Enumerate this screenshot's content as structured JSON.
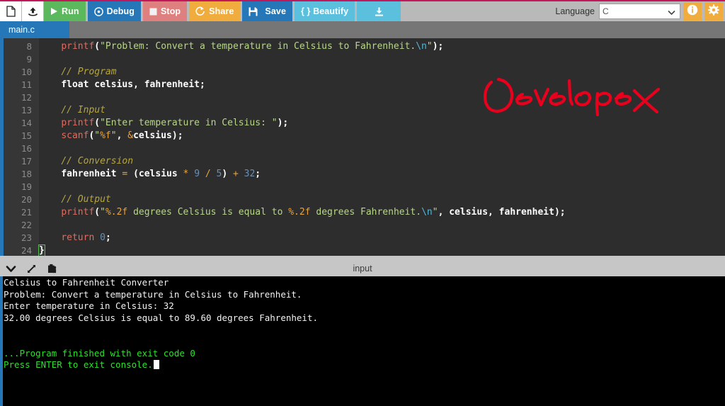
{
  "toolbar": {
    "buttons": [
      {
        "name": "new-file-button",
        "label": "",
        "icon": "file-icon"
      },
      {
        "name": "upload-button",
        "label": "",
        "icon": "upload-icon"
      },
      {
        "name": "run-button",
        "label": "Run",
        "icon": "play-icon"
      },
      {
        "name": "debug-button",
        "label": "Debug",
        "icon": "debug-icon"
      },
      {
        "name": "stop-button",
        "label": "Stop",
        "icon": "stop-icon"
      },
      {
        "name": "share-button",
        "label": "Share",
        "icon": "share-icon"
      },
      {
        "name": "save-button",
        "label": "Save",
        "icon": "floppy-icon"
      },
      {
        "name": "beautify-button",
        "label": "{ } Beautify",
        "icon": "braces-icon"
      },
      {
        "name": "download-button",
        "label": "",
        "icon": "download-icon"
      }
    ],
    "run_label": "Run",
    "debug_label": "Debug",
    "stop_label": "Stop",
    "share_label": "Share",
    "save_label": "Save",
    "beautify_label": "{ } Beautify",
    "language_label": "Language",
    "language_value": "C",
    "info_icon": "info-icon",
    "settings_icon": "gear-icon",
    "accent_pink": "#c2185b",
    "accent_green": "#5cb85c",
    "accent_blue": "#2577b8",
    "accent_orange": "#f0ad3e"
  },
  "tabs": [
    {
      "label": "main.c",
      "active": true
    }
  ],
  "editor": {
    "first_line_number": 8,
    "lines": [
      {
        "n": 8,
        "tokens": [
          {
            "t": "    ",
            "c": "pn"
          },
          {
            "t": "printf",
            "c": "fn"
          },
          {
            "t": "(",
            "c": "pn"
          },
          {
            "t": "\"Problem: Convert a temperature in Celsius to Fahrenheit.",
            "c": "str"
          },
          {
            "t": "\\n",
            "c": "esc"
          },
          {
            "t": "\"",
            "c": "str"
          },
          {
            "t": ");",
            "c": "pn"
          }
        ]
      },
      {
        "n": 9,
        "tokens": []
      },
      {
        "n": 10,
        "tokens": [
          {
            "t": "    ",
            "c": "pn"
          },
          {
            "t": "// Program",
            "c": "cmt"
          }
        ]
      },
      {
        "n": 11,
        "tokens": [
          {
            "t": "    ",
            "c": "pn"
          },
          {
            "t": "float",
            "c": "kw"
          },
          {
            "t": " celsius, fahrenheit;",
            "c": "id"
          }
        ]
      },
      {
        "n": 12,
        "tokens": []
      },
      {
        "n": 13,
        "tokens": [
          {
            "t": "    ",
            "c": "pn"
          },
          {
            "t": "// Input",
            "c": "cmt"
          }
        ]
      },
      {
        "n": 14,
        "tokens": [
          {
            "t": "    ",
            "c": "pn"
          },
          {
            "t": "printf",
            "c": "fn"
          },
          {
            "t": "(",
            "c": "pn"
          },
          {
            "t": "\"Enter temperature in Celsius: \"",
            "c": "str"
          },
          {
            "t": ");",
            "c": "pn"
          }
        ]
      },
      {
        "n": 15,
        "tokens": [
          {
            "t": "    ",
            "c": "pn"
          },
          {
            "t": "scanf",
            "c": "fn"
          },
          {
            "t": "(",
            "c": "pn"
          },
          {
            "t": "\"",
            "c": "str"
          },
          {
            "t": "%f",
            "c": "op"
          },
          {
            "t": "\"",
            "c": "str"
          },
          {
            "t": ", ",
            "c": "pn"
          },
          {
            "t": "&",
            "c": "op"
          },
          {
            "t": "celsius",
            "c": "id"
          },
          {
            "t": ");",
            "c": "pn"
          }
        ]
      },
      {
        "n": 16,
        "tokens": []
      },
      {
        "n": 17,
        "tokens": [
          {
            "t": "    ",
            "c": "pn"
          },
          {
            "t": "// Conversion",
            "c": "cmt"
          }
        ]
      },
      {
        "n": 18,
        "tokens": [
          {
            "t": "    ",
            "c": "pn"
          },
          {
            "t": "fahrenheit",
            "c": "id"
          },
          {
            "t": " ",
            "c": "pn"
          },
          {
            "t": "=",
            "c": "op"
          },
          {
            "t": " (celsius ",
            "c": "id"
          },
          {
            "t": "*",
            "c": "op"
          },
          {
            "t": " ",
            "c": "pn"
          },
          {
            "t": "9",
            "c": "num"
          },
          {
            "t": " ",
            "c": "pn"
          },
          {
            "t": "/",
            "c": "op"
          },
          {
            "t": " ",
            "c": "pn"
          },
          {
            "t": "5",
            "c": "num"
          },
          {
            "t": ") ",
            "c": "id"
          },
          {
            "t": "+",
            "c": "op"
          },
          {
            "t": " ",
            "c": "pn"
          },
          {
            "t": "32",
            "c": "num"
          },
          {
            "t": ";",
            "c": "pn"
          }
        ]
      },
      {
        "n": 19,
        "tokens": []
      },
      {
        "n": 20,
        "tokens": [
          {
            "t": "    ",
            "c": "pn"
          },
          {
            "t": "// Output",
            "c": "cmt"
          }
        ]
      },
      {
        "n": 21,
        "tokens": [
          {
            "t": "    ",
            "c": "pn"
          },
          {
            "t": "printf",
            "c": "fn"
          },
          {
            "t": "(",
            "c": "pn"
          },
          {
            "t": "\"",
            "c": "str"
          },
          {
            "t": "%.2f",
            "c": "op"
          },
          {
            "t": " degrees Celsius is equal to ",
            "c": "str"
          },
          {
            "t": "%.2f",
            "c": "op"
          },
          {
            "t": " degrees Fahrenheit.",
            "c": "str"
          },
          {
            "t": "\\n",
            "c": "esc"
          },
          {
            "t": "\"",
            "c": "str"
          },
          {
            "t": ", celsius, fahrenheit);",
            "c": "pn"
          }
        ]
      },
      {
        "n": 22,
        "tokens": []
      },
      {
        "n": 23,
        "tokens": [
          {
            "t": "    ",
            "c": "pn"
          },
          {
            "t": "return",
            "c": "ret"
          },
          {
            "t": " ",
            "c": "pn"
          },
          {
            "t": "0",
            "c": "num"
          },
          {
            "t": ";",
            "c": "pn"
          }
        ]
      },
      {
        "n": 24,
        "tokens": [
          {
            "t": "}",
            "c": "brace-hl"
          }
        ]
      }
    ],
    "annotation_text": "Developer",
    "annotation_color": "#e8001c"
  },
  "console_header": {
    "title": "input",
    "icons": [
      "chevron-down-icon",
      "expand-icon",
      "clipboard-icon"
    ]
  },
  "console": {
    "lines": [
      {
        "text": "Celsius to Fahrenheit Converter",
        "color": "white"
      },
      {
        "text": "Problem: Convert a temperature in Celsius to Fahrenheit.",
        "color": "white"
      },
      {
        "text": "Enter temperature in Celsius: 32",
        "color": "white"
      },
      {
        "text": "32.00 degrees Celsius is equal to 89.60 degrees Fahrenheit.",
        "color": "white"
      },
      {
        "text": "",
        "color": "white"
      },
      {
        "text": "",
        "color": "white"
      },
      {
        "text": "...Program finished with exit code 0",
        "color": "green"
      },
      {
        "text": "Press ENTER to exit console.",
        "color": "green",
        "cursor": true
      }
    ]
  }
}
